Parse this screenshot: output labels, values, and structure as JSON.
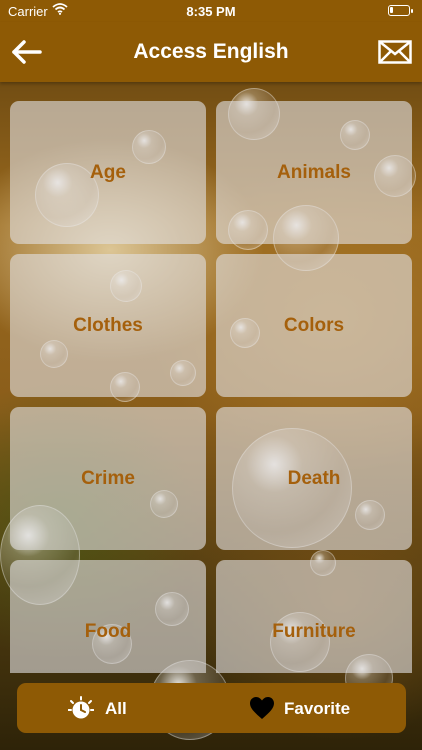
{
  "status_bar": {
    "carrier": "Carrier",
    "time": "8:35 PM",
    "battery_level": 0.15
  },
  "nav": {
    "title": "Access English",
    "back_icon": "back-arrow-icon",
    "mail_icon": "envelope-icon"
  },
  "categories": [
    {
      "label": "Age"
    },
    {
      "label": "Animals"
    },
    {
      "label": "Clothes"
    },
    {
      "label": "Colors"
    },
    {
      "label": "Crime"
    },
    {
      "label": "Death"
    },
    {
      "label": "Food"
    },
    {
      "label": "Furniture"
    }
  ],
  "tabbar": {
    "all_label": "All",
    "all_icon": "clock-sparkle-icon",
    "favorite_label": "Favorite",
    "favorite_icon": "heart-icon"
  },
  "colors": {
    "brand": "#8e5a05",
    "tile_text": "#a5600c",
    "tile_bg": "rgba(225,222,225,0.62)"
  }
}
